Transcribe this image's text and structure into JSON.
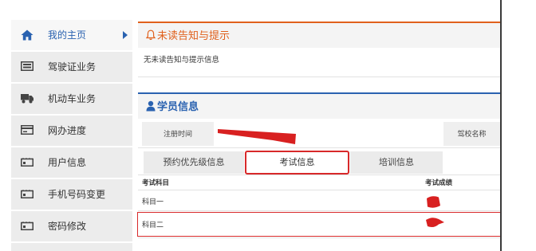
{
  "sidebar": {
    "items": [
      {
        "label": "我的主页",
        "icon": "home-icon",
        "active": true
      },
      {
        "label": "驾驶证业务",
        "icon": "id-card-icon"
      },
      {
        "label": "机动车业务",
        "icon": "truck-icon"
      },
      {
        "label": "网办进度",
        "icon": "progress-card-icon"
      },
      {
        "label": "用户信息",
        "icon": "user-info-card-icon"
      },
      {
        "label": "手机号码变更",
        "icon": "phone-card-icon"
      },
      {
        "label": "密码修改",
        "icon": "password-card-icon"
      }
    ]
  },
  "notice_panel": {
    "icon": "bell-icon",
    "title": "未读告知与提示",
    "message": "无未读告知与提示信息"
  },
  "student_panel": {
    "icon": "user-icon",
    "title": "学员信息",
    "fields": [
      {
        "label": "注册时间"
      },
      {
        "label": "驾校名称"
      }
    ],
    "tabs": [
      {
        "label": "预约优先级信息"
      },
      {
        "label": "考试信息",
        "active": true
      },
      {
        "label": "培训信息"
      }
    ],
    "exam_table": {
      "columns": [
        "考试科目",
        "考试成绩"
      ],
      "rows": [
        {
          "subject": "科目一"
        },
        {
          "subject": "科目二"
        }
      ]
    }
  },
  "colors": {
    "accent_blue": "#2a62b0",
    "notice_orange": "#e0601c",
    "annotation_red": "#d8292a",
    "sidebar_bg": "#ececec"
  }
}
